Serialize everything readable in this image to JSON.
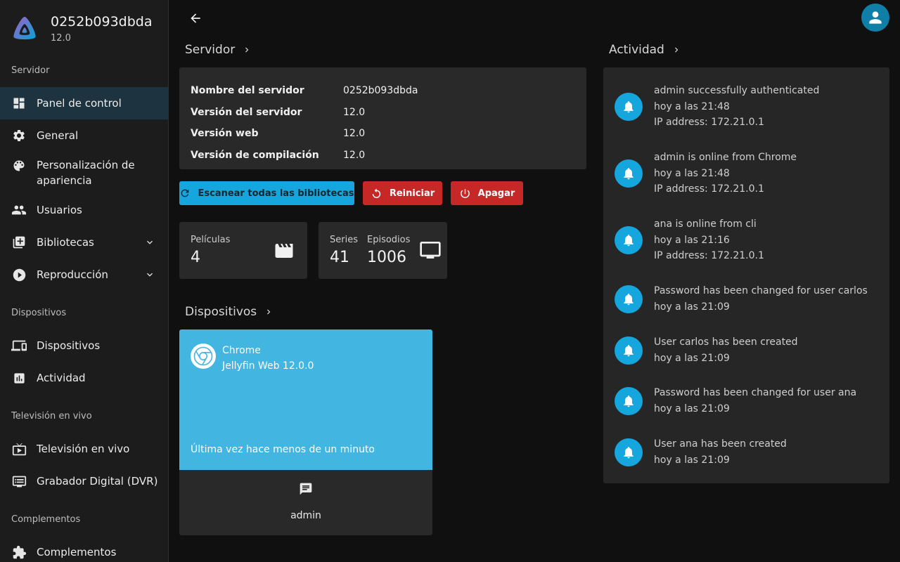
{
  "app": {
    "server_name": "0252b093dbda",
    "version": "12.0"
  },
  "sidebar": {
    "sections": [
      {
        "label": "Servidor"
      },
      {
        "label": "Dispositivos"
      },
      {
        "label": "Televisión en vivo"
      },
      {
        "label": "Complementos"
      }
    ],
    "items": [
      {
        "label": "Panel de control"
      },
      {
        "label": "General"
      },
      {
        "label": "Personalización de apariencia"
      },
      {
        "label": "Usuarios"
      },
      {
        "label": "Bibliotecas"
      },
      {
        "label": "Reproducción"
      },
      {
        "label": "Dispositivos"
      },
      {
        "label": "Actividad"
      },
      {
        "label": "Televisión en vivo"
      },
      {
        "label": "Grabador Digital (DVR)"
      },
      {
        "label": "Complementos"
      }
    ]
  },
  "server": {
    "heading": "Servidor",
    "rows": [
      {
        "key": "Nombre del servidor",
        "value": "0252b093dbda"
      },
      {
        "key": "Versión del servidor",
        "value": "12.0"
      },
      {
        "key": "Versión web",
        "value": "12.0"
      },
      {
        "key": "Versión de compilación",
        "value": "12.0"
      }
    ]
  },
  "actions": {
    "scan": "Escanear todas las bibliotecas",
    "restart": "Reiniciar",
    "shutdown": "Apagar"
  },
  "stats": {
    "movies_label": "Películas",
    "movies_value": "4",
    "series_label": "Series",
    "series_value": "41",
    "episodes_label": "Episodios",
    "episodes_value": "1006"
  },
  "devices": {
    "heading": "Dispositivos",
    "card": {
      "client": "Chrome",
      "app": "Jellyfin Web 12.0.0",
      "last_seen": "Última vez hace menos de un minuto",
      "user": "admin"
    }
  },
  "activity": {
    "heading": "Actividad",
    "items": [
      {
        "title": "admin successfully authenticated",
        "time": "hoy a las 21:48",
        "detail": "IP address: 172.21.0.1"
      },
      {
        "title": "admin is online from Chrome",
        "time": "hoy a las 21:48",
        "detail": "IP address: 172.21.0.1"
      },
      {
        "title": "ana is online from cli",
        "time": "hoy a las 21:16",
        "detail": "IP address: 172.21.0.1"
      },
      {
        "title": "Password has been changed for user carlos",
        "time": "hoy a las 21:09"
      },
      {
        "title": "User carlos has been created",
        "time": "hoy a las 21:09"
      },
      {
        "title": "Password has been changed for user ana",
        "time": "hoy a las 21:09"
      },
      {
        "title": "User ana has been created",
        "time": "hoy a las 21:09"
      }
    ]
  },
  "colors": {
    "accent": "#16a6de",
    "danger": "#c62828",
    "device_card": "#42b5e0",
    "active_nav": "#1d3440"
  },
  "icons": [
    "jellyfin-logo",
    "dashboard-icon",
    "gear-icon",
    "palette-icon",
    "users-icon",
    "library-add-icon",
    "play-circle-icon",
    "devices-icon",
    "chart-icon",
    "live-tv-icon",
    "dvr-icon",
    "extension-icon",
    "back-arrow-icon",
    "account-icon",
    "refresh-icon",
    "restart-icon",
    "power-icon",
    "movie-icon",
    "tv-icon",
    "chrome-icon",
    "message-icon",
    "bell-icon",
    "chevron-right-icon",
    "chevron-down-icon"
  ]
}
